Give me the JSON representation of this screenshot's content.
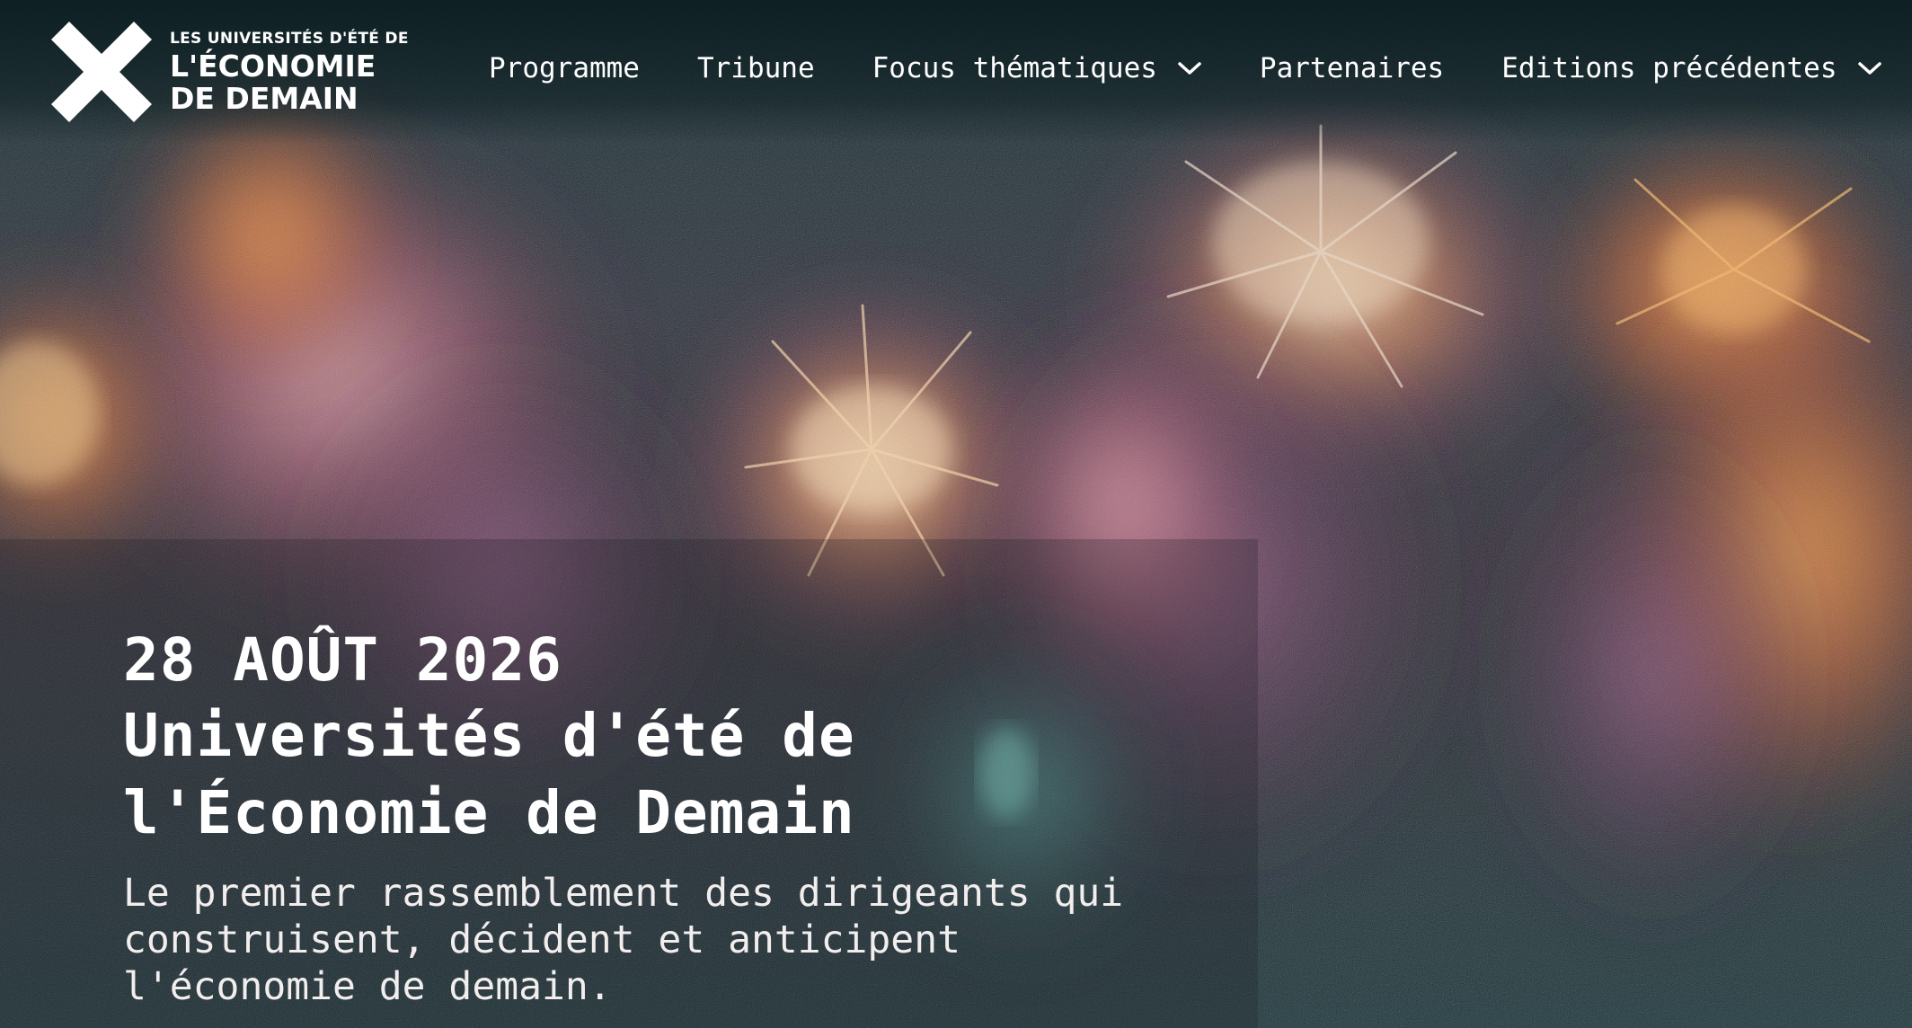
{
  "brand": {
    "line1": "LES UNIVERSITÉS D'ÉTÉ DE",
    "line2": "L'ÉCONOMIE",
    "line3": "DE DEMAIN"
  },
  "nav": {
    "items": [
      {
        "label": "Programme",
        "has_dropdown": false
      },
      {
        "label": "Tribune",
        "has_dropdown": false
      },
      {
        "label": "Focus thématiques",
        "has_dropdown": true
      },
      {
        "label": "Partenaires",
        "has_dropdown": false
      },
      {
        "label": "Editions précédentes",
        "has_dropdown": true
      }
    ]
  },
  "hero": {
    "date": "28 AOÛT 2026",
    "title": "Universités d'été de l'Économie de Demain",
    "subtitle": "Le premier rassemblement des dirigeants qui construisent, décident et anticipent l'économie de demain."
  },
  "icons": {
    "logo": "x-cross-logo-icon",
    "dropdown": "chevron-down-icon"
  },
  "colors": {
    "background": "#16242a",
    "text": "#ffffff",
    "accent_orange": "#e0742a",
    "accent_pink": "#c8607a"
  }
}
